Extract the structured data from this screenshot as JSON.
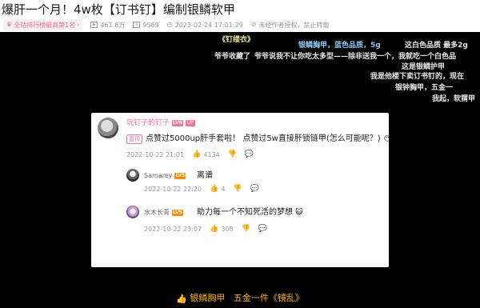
{
  "header": {
    "title": "爆肝一个月！4w枚【订书钉】编制银鳞软甲",
    "rank_label": "全站排行榜最高第1名",
    "views": "461.6万",
    "danmaku_count": "9569",
    "datetime": "2023-02-24 17:01:29",
    "copyright": "未经作者授权，禁止转载"
  },
  "danmaku": [
    {
      "text": "《钉缕衣》",
      "cls": "yellow"
    },
    {
      "text": "银鳞胸甲，蓝色品质，5g",
      "cls": "blue"
    },
    {
      "text": "这白色品质 最多2g",
      "cls": "grey"
    },
    {
      "text": "爷爷收藏了",
      "cls": "grey"
    },
    {
      "text": "爷爷说我不让你吃太多型——除非送我一个，我就吃一个白色品",
      "cls": "grey"
    },
    {
      "text": "这是银鳞护甲",
      "cls": "grey"
    },
    {
      "text": "我是他楼下卖订书钉的，现在",
      "cls": "grey"
    },
    {
      "text": "银钟胸甲，五金一",
      "cls": "grey"
    },
    {
      "text": "我起，软猬甲",
      "cls": "grey"
    }
  ],
  "comment": {
    "username": "玩钉子的钉子",
    "level": "LV6",
    "up_tag": "UP",
    "pin_label": "置顶",
    "text": "点赞过5000up肝手套啦！ 点赞过5w直接肝锁链甲(怎么可能呢？)",
    "time": "2022-10-22 21:01",
    "likes": "4134",
    "replies": [
      {
        "username": "Samarey",
        "level": "LV5",
        "text": "离谱",
        "time": "2022-10-22 22:20",
        "likes": "4"
      },
      {
        "username": "水木长青",
        "level": "LV5",
        "text": "助力每一个不知死活的梦想",
        "time": "2022-10-22 23:07",
        "likes": "308"
      }
    ]
  },
  "subtitle": {
    "part1": "银鳞胸甲",
    "part2": "五金一件《镜乱》"
  }
}
